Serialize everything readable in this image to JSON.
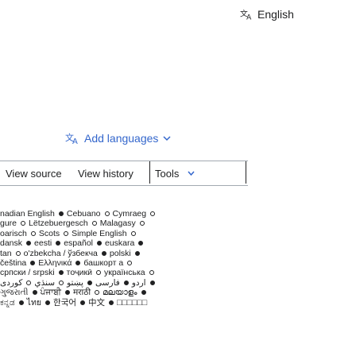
{
  "top_language_button": {
    "label": "English",
    "icon": "translate-icon"
  },
  "add_languages": {
    "label": "Add languages",
    "icon": "translate-icon"
  },
  "tabs": {
    "view_source": "View source",
    "view_history": "View history",
    "tools": "Tools"
  },
  "language_lines": [
    [
      {
        "text": "nadian English",
        "dot": "filled"
      },
      {
        "text": "Cebuano",
        "dot": "ring"
      },
      {
        "text": "Cymraeg",
        "dot": "ring"
      }
    ],
    [
      {
        "text": "gure",
        "dot": "ring"
      },
      {
        "text": "Lëtzebuergesch",
        "dot": "ring"
      },
      {
        "text": "Malagasy",
        "dot": "ring"
      }
    ],
    [
      {
        "text": "oarisch",
        "dot": "ring"
      },
      {
        "text": "Scots",
        "dot": "ring"
      },
      {
        "text": "Simple English",
        "dot": "ring"
      }
    ],
    [
      {
        "text": "dansk",
        "dot": "filled"
      },
      {
        "text": "eesti",
        "dot": "filled"
      },
      {
        "text": "español",
        "dot": "filled"
      },
      {
        "text": "euskara",
        "dot": "filled"
      }
    ],
    [
      {
        "text": "tan",
        "dot": "ring"
      },
      {
        "text": "o'zbekcha / ўзбекча",
        "dot": "filled"
      },
      {
        "text": "polski",
        "dot": "filled"
      }
    ],
    [
      {
        "text": "čeština",
        "dot": "filled"
      },
      {
        "text": "Ελληνικά",
        "dot": "filled"
      },
      {
        "text": "башкорт а",
        "dot": "ring"
      }
    ],
    [
      {
        "text": "српски / srpski",
        "dot": "filled"
      },
      {
        "text": "тоҷикӣ",
        "dot": "ring"
      },
      {
        "text": "українська",
        "dot": "ring"
      }
    ],
    [
      {
        "text": "اردو",
        "dot": "filled"
      },
      {
        "text": "فارسی",
        "dot": "filled"
      },
      {
        "text": "پښتو",
        "dot": "ring"
      },
      {
        "text": "سنڌي",
        "dot": "ring"
      },
      {
        "text": "کوردی",
        "dot": "filled"
      }
    ],
    [
      {
        "text": "ગુજરાતી",
        "dot": "filled"
      },
      {
        "text": "ਪੰਜਾਬੀ",
        "dot": "filled"
      },
      {
        "text": "मराठी",
        "dot": "ring"
      },
      {
        "text": "മലയാളം",
        "dot": "filled"
      }
    ],
    [
      {
        "text": "ಕನ್ನಡ",
        "dot": "filled"
      },
      {
        "text": "ไทย",
        "dot": "filled"
      },
      {
        "text": "한국어",
        "dot": "filled"
      },
      {
        "text": "中文",
        "dot": "filled"
      },
      {
        "text": "□□□□□□",
        "dot": ""
      }
    ]
  ]
}
